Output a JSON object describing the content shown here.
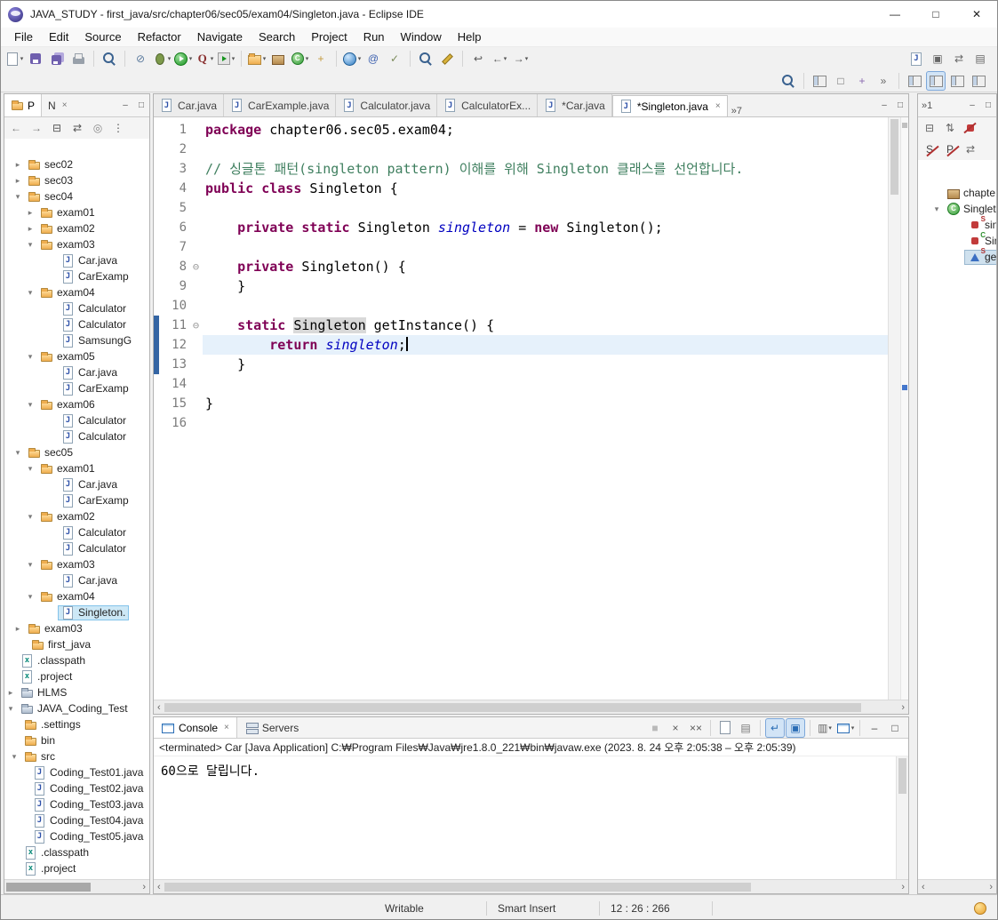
{
  "window": {
    "title": "JAVA_STUDY - first_java/src/chapter06/sec05/exam04/Singleton.java - Eclipse IDE"
  },
  "menu": [
    "File",
    "Edit",
    "Source",
    "Refactor",
    "Navigate",
    "Search",
    "Project",
    "Run",
    "Window",
    "Help"
  ],
  "toolbar": {
    "row1": [
      [
        {
          "n": "new-wizard",
          "k": "doc",
          "caret": 1
        },
        {
          "n": "save",
          "k": "floppy"
        },
        {
          "n": "save-all",
          "k": "floppy2"
        },
        {
          "n": "print",
          "k": "print"
        }
      ],
      [
        {
          "n": "open-type",
          "k": "mag"
        }
      ],
      [
        {
          "n": "skip-all-breakpoints",
          "g": "⊘",
          "c": "#5b7a9d"
        },
        {
          "n": "debug",
          "k": "bug",
          "caret": 1
        },
        {
          "n": "run",
          "k": "runc",
          "caret": 1
        },
        {
          "n": "profile",
          "k": "q",
          "t": "Q",
          "caret": 1
        },
        {
          "n": "external-tools",
          "k": "ext",
          "caret": 1
        }
      ],
      [
        {
          "n": "new-java-project",
          "k": "folder",
          "caret": 1
        },
        {
          "n": "new-package",
          "k": "pkg"
        },
        {
          "n": "new-class",
          "k": "cls",
          "caret": 1
        },
        {
          "n": "new-wizard-misc",
          "g": "+",
          "c": "#c39a3d"
        }
      ],
      [
        {
          "n": "open-web-browser",
          "k": "globe",
          "caret": 1
        },
        {
          "n": "generate-javadoc",
          "g": "@",
          "c": "#3a5fae"
        },
        {
          "n": "new-task",
          "g": "✓",
          "c": "#7a8a5a"
        }
      ],
      [
        {
          "n": "search",
          "k": "mag"
        },
        {
          "n": "toggle-mark-occurrences",
          "k": "pencil"
        }
      ],
      [
        {
          "n": "last-edit-location",
          "g": "↩",
          "c": "#555"
        },
        {
          "n": "back",
          "g": "←",
          "c": "#555",
          "caret": 1
        },
        {
          "n": "forward",
          "g": "→",
          "c": "#555",
          "caret": 1
        }
      ]
    ],
    "row1_right": [
      [
        {
          "n": "show-source-menu",
          "k": "jfile"
        },
        {
          "n": "pin-editor",
          "g": "▣",
          "c": "#666"
        },
        {
          "n": "link-with-editor",
          "g": "⇄",
          "c": "#666"
        },
        {
          "n": "toggle-breadcrumb",
          "g": "▤",
          "c": "#666"
        }
      ]
    ],
    "row2": [
      [
        {
          "n": "quick-access-search",
          "k": "mag"
        }
      ],
      [
        {
          "n": "open-perspective",
          "k": "persp"
        },
        {
          "n": "restore-views",
          "g": "□",
          "c": "#666"
        },
        {
          "n": "editor-presentation",
          "g": "+",
          "c": "#8a6ab0"
        },
        {
          "n": "toolbar-more",
          "g": "»",
          "c": "#666"
        }
      ],
      [
        {
          "n": "java-ee-perspective",
          "k": "persp"
        },
        {
          "n": "java-perspective",
          "k": "persp",
          "pressed": 1
        },
        {
          "n": "debug-perspective",
          "k": "persp"
        },
        {
          "n": "git-perspective",
          "k": "persp"
        }
      ]
    ]
  },
  "package_explorer": {
    "tab_explorer": "P",
    "tab_navigator": "N",
    "toolbar": [
      {
        "n": "back",
        "g": "←",
        "c": "#777"
      },
      {
        "n": "forward",
        "g": "→",
        "c": "#777"
      },
      {
        "n": "collapse-all",
        "g": "⊟",
        "c": "#555"
      },
      {
        "n": "link-with-editor",
        "g": "⇄",
        "c": "#555"
      },
      {
        "n": "focus",
        "g": "◎",
        "c": "#888"
      },
      {
        "n": "view-menu",
        "g": "⋮",
        "c": "#555"
      }
    ],
    "tree": [
      {
        "l": "sec02",
        "ind": 8,
        "a": "c",
        "i": "f"
      },
      {
        "l": "sec03",
        "ind": 8,
        "a": "c",
        "i": "f"
      },
      {
        "l": "sec04",
        "ind": 8,
        "a": "e",
        "i": "f"
      },
      {
        "l": "exam01",
        "ind": 22,
        "a": "c",
        "i": "f"
      },
      {
        "l": "exam02",
        "ind": 22,
        "a": "c",
        "i": "f"
      },
      {
        "l": "exam03",
        "ind": 22,
        "a": "e",
        "i": "f"
      },
      {
        "l": "Car.java",
        "ind": 46,
        "i": "j"
      },
      {
        "l": "CarExamp",
        "ind": 46,
        "i": "j"
      },
      {
        "l": "exam04",
        "ind": 22,
        "a": "e",
        "i": "f"
      },
      {
        "l": "Calculator",
        "ind": 46,
        "i": "j"
      },
      {
        "l": "Calculator",
        "ind": 46,
        "i": "j"
      },
      {
        "l": "SamsungG",
        "ind": 46,
        "i": "j"
      },
      {
        "l": "exam05",
        "ind": 22,
        "a": "e",
        "i": "f"
      },
      {
        "l": "Car.java",
        "ind": 46,
        "i": "j"
      },
      {
        "l": "CarExamp",
        "ind": 46,
        "i": "j"
      },
      {
        "l": "exam06",
        "ind": 22,
        "a": "e",
        "i": "f"
      },
      {
        "l": "Calculator",
        "ind": 46,
        "i": "j"
      },
      {
        "l": "Calculator",
        "ind": 46,
        "i": "j"
      },
      {
        "l": "sec05",
        "ind": 8,
        "a": "e",
        "i": "f"
      },
      {
        "l": "exam01",
        "ind": 22,
        "a": "e",
        "i": "f"
      },
      {
        "l": "Car.java",
        "ind": 46,
        "i": "j"
      },
      {
        "l": "CarExamp",
        "ind": 46,
        "i": "j"
      },
      {
        "l": "exam02",
        "ind": 22,
        "a": "e",
        "i": "f"
      },
      {
        "l": "Calculator",
        "ind": 46,
        "i": "j"
      },
      {
        "l": "Calculator",
        "ind": 46,
        "i": "j"
      },
      {
        "l": "exam03",
        "ind": 22,
        "a": "e",
        "i": "f"
      },
      {
        "l": "Car.java",
        "ind": 46,
        "i": "j"
      },
      {
        "l": "exam04",
        "ind": 22,
        "a": "e",
        "i": "f"
      },
      {
        "l": "Singleton.",
        "ind": 46,
        "i": "j",
        "sel": 1
      },
      {
        "l": "exam03",
        "ind": 8,
        "a": "c",
        "i": "f"
      },
      {
        "l": "first_java",
        "ind": 12,
        "i": "f"
      },
      {
        "l": ".classpath",
        "ind": 0,
        "i": "x"
      },
      {
        "l": ".project",
        "ind": 0,
        "i": "x"
      },
      {
        "l": "HLMS",
        "ind": 0,
        "a": "c",
        "i": "p"
      },
      {
        "l": "JAVA_Coding_Test",
        "ind": 0,
        "a": "e",
        "i": "p"
      },
      {
        "l": ".settings",
        "ind": 4,
        "i": "f"
      },
      {
        "l": "bin",
        "ind": 4,
        "i": "f"
      },
      {
        "l": "src",
        "ind": 4,
        "a": "e",
        "i": "f"
      },
      {
        "l": "Coding_Test01.java",
        "ind": 14,
        "i": "j"
      },
      {
        "l": "Coding_Test02.java",
        "ind": 14,
        "i": "j"
      },
      {
        "l": "Coding_Test03.java",
        "ind": 14,
        "i": "j"
      },
      {
        "l": "Coding_Test04.java",
        "ind": 14,
        "i": "j"
      },
      {
        "l": "Coding_Test05.java",
        "ind": 14,
        "i": "j"
      },
      {
        "l": ".classpath",
        "ind": 4,
        "i": "x"
      },
      {
        "l": ".project",
        "ind": 4,
        "i": "x"
      }
    ]
  },
  "editor": {
    "tabs": [
      {
        "label": "Car.java"
      },
      {
        "label": "CarExample.java"
      },
      {
        "label": "Calculator.java"
      },
      {
        "label": "CalculatorEx..."
      },
      {
        "label": "*Car.java"
      },
      {
        "label": "*Singleton.java",
        "selected": 1
      }
    ],
    "overflow": "7",
    "code": [
      {
        "n": "1",
        "tokens": [
          [
            "kw",
            "package"
          ],
          [
            "pl",
            " chapter06.sec05.exam04;"
          ]
        ]
      },
      {
        "n": "2",
        "tokens": []
      },
      {
        "n": "3",
        "tokens": [
          [
            "cm",
            "// 싱글톤 패턴(singleton pattern) 이해를 위해 Singleton 클래스를 선언합니다."
          ]
        ]
      },
      {
        "n": "4",
        "tokens": [
          [
            "kw",
            "public class"
          ],
          [
            "pl",
            " Singleton {"
          ]
        ]
      },
      {
        "n": "5",
        "tokens": []
      },
      {
        "n": "6",
        "tokens": [
          [
            "pl",
            "    "
          ],
          [
            "kw",
            "private static"
          ],
          [
            "pl",
            " Singleton "
          ],
          [
            "fld",
            "singleton"
          ],
          [
            "pl",
            " = "
          ],
          [
            "kw",
            "new"
          ],
          [
            "pl",
            " Singleton();"
          ]
        ]
      },
      {
        "n": "7",
        "tokens": []
      },
      {
        "n": "8",
        "fold": 1,
        "tokens": [
          [
            "pl",
            "    "
          ],
          [
            "kw",
            "private"
          ],
          [
            "pl",
            " Singleton() {"
          ]
        ]
      },
      {
        "n": "9",
        "tokens": [
          [
            "pl",
            "    }"
          ]
        ]
      },
      {
        "n": "10",
        "tokens": []
      },
      {
        "n": "11",
        "fold": 1,
        "range": 1,
        "tokens": [
          [
            "pl",
            "    "
          ],
          [
            "kw",
            "static"
          ],
          [
            "pl",
            " "
          ],
          [
            "occ",
            "Singleton"
          ],
          [
            "pl",
            " getInstance() {"
          ]
        ]
      },
      {
        "n": "12",
        "current": 1,
        "range": 1,
        "tokens": [
          [
            "pl",
            "        "
          ],
          [
            "kw",
            "return"
          ],
          [
            "pl",
            " "
          ],
          [
            "fld",
            "singleton"
          ],
          [
            "pl",
            ";"
          ],
          [
            "cursor",
            ""
          ]
        ]
      },
      {
        "n": "13",
        "range": 1,
        "tokens": [
          [
            "pl",
            "    }"
          ]
        ]
      },
      {
        "n": "14",
        "tokens": []
      },
      {
        "n": "15",
        "tokens": [
          [
            "pl",
            "}"
          ]
        ]
      },
      {
        "n": "16",
        "tokens": []
      }
    ]
  },
  "outline": {
    "overflow": "1",
    "toolbar": [
      [
        {
          "n": "collapse-all",
          "g": "⊟",
          "c": "#666"
        },
        {
          "n": "sort",
          "g": "⇅",
          "c": "#666"
        },
        {
          "n": "hide-fields",
          "k": "fld",
          "slash": 1
        }
      ],
      [
        {
          "n": "hide-static-members",
          "g": "S",
          "c": "#444",
          "slash": 1
        },
        {
          "n": "hide-non-public",
          "g": "P",
          "c": "#444",
          "slash": 1
        },
        {
          "n": "link-with-editor",
          "g": "⇄",
          "c": "#666"
        }
      ]
    ],
    "items": [
      {
        "l": "chapte",
        "ic": "pkg",
        "ind": 14
      },
      {
        "l": "Singlet",
        "ic": "cls",
        "ind": 14,
        "arrow": "e"
      },
      {
        "l": "sing",
        "ic": "fld",
        "dec": "S",
        "ind": 38
      },
      {
        "l": "Sing",
        "ic": "fld",
        "dec": "C",
        "ind": 38
      },
      {
        "l": "getI",
        "ic": "tri",
        "dec": "S",
        "ind": 38,
        "sel": 1
      }
    ]
  },
  "console": {
    "tab_console": "Console",
    "tab_servers": "Servers",
    "toolbar": [
      [
        {
          "n": "terminate",
          "g": "■",
          "c": "#b9b9b9"
        },
        {
          "n": "remove-launch",
          "g": "×",
          "c": "#5a5a5a"
        },
        {
          "n": "remove-all-terminated",
          "g": "××",
          "c": "#5a5a5a"
        }
      ],
      [
        {
          "n": "clear-console",
          "k": "doc"
        },
        {
          "n": "scroll-lock",
          "g": "▤",
          "c": "#777"
        }
      ],
      [
        {
          "n": "word-wrap",
          "g": "↵",
          "c": "#2a6db5",
          "pressed": 1
        },
        {
          "n": "pin-console",
          "g": "▣",
          "c": "#2a6db5",
          "pressed": 1
        }
      ],
      [
        {
          "n": "display-selected-console",
          "g": "▥",
          "c": "#666",
          "caret": 1
        },
        {
          "n": "open-console",
          "k": "consoleic",
          "caret": 1
        }
      ],
      [
        {
          "n": "minimize-view",
          "g": "–",
          "c": "#444"
        },
        {
          "n": "maximize-view",
          "g": "□",
          "c": "#444"
        }
      ]
    ],
    "message": "<terminated> Car [Java Application] C:₩Program Files₩Java₩jre1.8.0_221₩bin₩javaw.exe  (2023. 8. 24 오후 2:05:38 – 오후 2:05:39)",
    "output": "60으로 달립니다."
  },
  "status": {
    "writable": "Writable",
    "insert": "Smart Insert",
    "position": "12 : 26 : 266"
  }
}
